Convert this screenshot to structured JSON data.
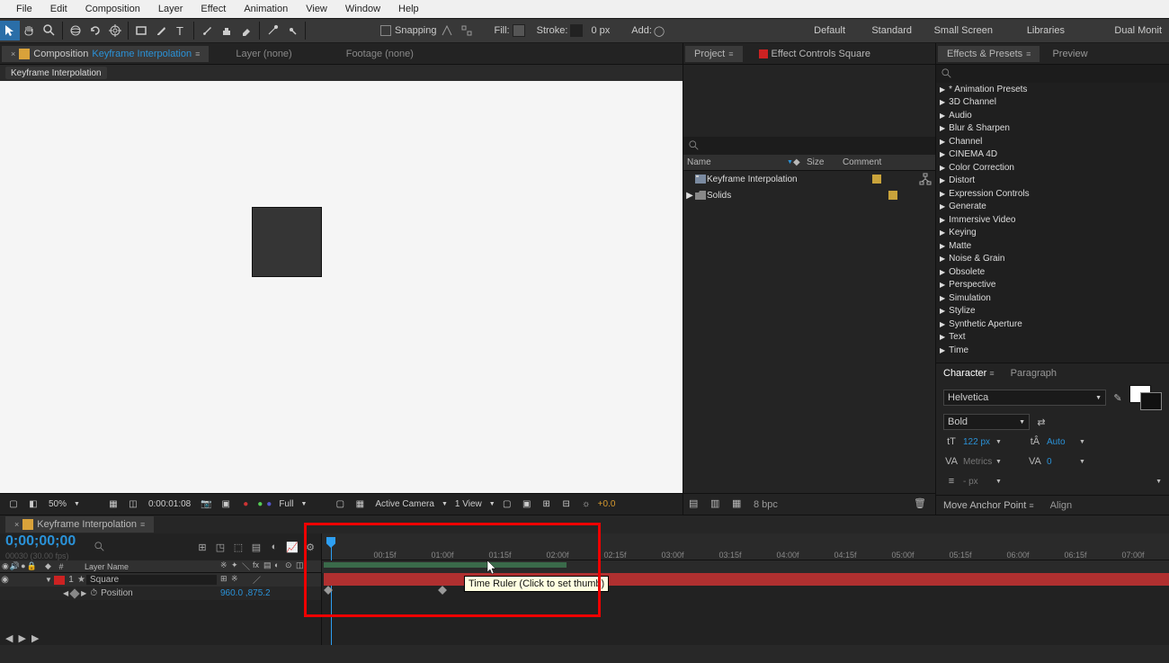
{
  "menu": [
    "File",
    "Edit",
    "Composition",
    "Layer",
    "Effect",
    "Animation",
    "View",
    "Window",
    "Help"
  ],
  "toolbar": {
    "snapping": "Snapping",
    "fill": "Fill:",
    "stroke": "Stroke:",
    "px": "0 px",
    "add": "Add:"
  },
  "workspaces": [
    "Default",
    "Standard",
    "Small Screen",
    "Libraries",
    "Dual Monit"
  ],
  "comp": {
    "tab_prefix": "Composition",
    "name": "Keyframe Interpolation",
    "layer_none": "Layer (none)",
    "footage_none": "Footage (none)",
    "breadcrumb": "Keyframe Interpolation"
  },
  "viewer": {
    "magnification": "50%",
    "timecode": "0:00:01:08",
    "resolution": "Full",
    "camera": "Active Camera",
    "views": "1 View",
    "exposure": "+0.0"
  },
  "project": {
    "tab": "Project",
    "effect_controls": "Effect Controls",
    "ec_layer": "Square",
    "search_ph": "",
    "cols": {
      "name": "Name",
      "size": "Size",
      "comment": "Comment"
    },
    "items": [
      {
        "type": "comp",
        "name": "Keyframe Interpolation"
      },
      {
        "type": "folder",
        "name": "Solids"
      }
    ],
    "bpc": "8 bpc"
  },
  "effects": {
    "tab": "Effects & Presets",
    "preview": "Preview",
    "list": [
      "* Animation Presets",
      "3D Channel",
      "Audio",
      "Blur & Sharpen",
      "Channel",
      "CINEMA 4D",
      "Color Correction",
      "Distort",
      "Expression Controls",
      "Generate",
      "Immersive Video",
      "Keying",
      "Matte",
      "Noise & Grain",
      "Obsolete",
      "Perspective",
      "Simulation",
      "Stylize",
      "Synthetic Aperture",
      "Text",
      "Time"
    ]
  },
  "character": {
    "tab": "Character",
    "paragraph": "Paragraph",
    "font": "Helvetica",
    "style": "Bold",
    "size": "122 px",
    "leading": "Auto",
    "tracking": "Metrics",
    "baseline": "0",
    "unit": "- px"
  },
  "align": {
    "map": "Move Anchor Point",
    "align": "Align"
  },
  "timeline": {
    "tab": "Keyframe Interpolation",
    "timecode": "0;00;00;00",
    "sub": "00030 (30.00 fps)",
    "layer_name_hdr": "Layer Name",
    "layer": {
      "idx": "1",
      "name": "Square",
      "prop": "Position",
      "val": "960.0 ,875.2"
    },
    "ticks": [
      "00:15f",
      "01:00f",
      "01:15f",
      "02:00f",
      "02:15f",
      "03:00f",
      "03:15f",
      "04:00f",
      "04:15f",
      "05:00f",
      "05:15f",
      "06:00f",
      "06:15f",
      "07:00f"
    ],
    "tooltip": "Time Ruler (Click to set thumb)"
  }
}
